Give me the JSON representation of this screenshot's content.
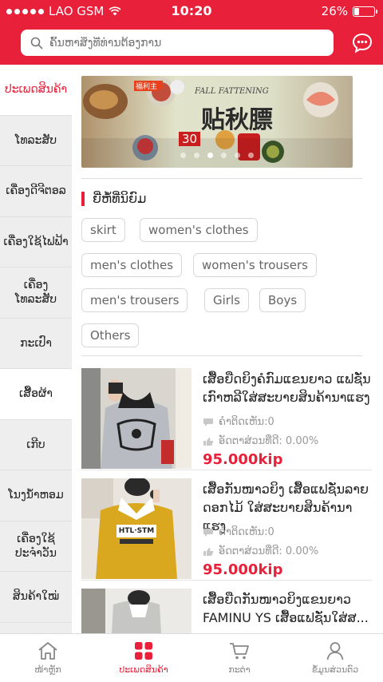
{
  "status_bar": {
    "carrier": "LAO GSM",
    "time": "10:20",
    "battery": "26%",
    "battery_level": 0.26
  },
  "search": {
    "placeholder": "ຄົ້ນຫາສິ່ງທີ່ທ່ານຕ້ອງການ"
  },
  "sidebar": {
    "items": [
      {
        "label": "ປະເພດສິນຄ້າ"
      },
      {
        "label": "ໂທລະສັບ"
      },
      {
        "label": "ເຄື່ອງດີຈີຕອລ"
      },
      {
        "label": "ເຄື່ອງໃຊ້ໄຟຟ້າ"
      },
      {
        "label": "ເຄື່ອງໂທລະສັບ"
      },
      {
        "label": "ກະເປົາ"
      },
      {
        "label": "ເສື້ອຜ້າ"
      },
      {
        "label": "ເກີບ"
      },
      {
        "label": "ໂນງນ້ຳຫອມ"
      },
      {
        "label": "ເຄື່ອງໃຊ້ ປະຈຳວັນ"
      },
      {
        "label": "ສິນຄ້າໃໝ່"
      }
    ]
  },
  "section": {
    "title": "ຍີ່ຫໍ້ທີ່ນິຍົມ"
  },
  "tags": [
    {
      "label": "skirt"
    },
    {
      "label": "women's clothes"
    },
    {
      "label": "men's clothes"
    },
    {
      "label": "women's trousers"
    },
    {
      "label": "men's trousers"
    },
    {
      "label": "Girls"
    },
    {
      "label": "Boys"
    },
    {
      "label": "Others"
    }
  ],
  "products": [
    {
      "title": "ເສື້ອຍືດຍິງຄໍກົມແຂນຍາວ ແຟຊັ່ນເກົາຫລີໃສ່ສະບາຍສິນຄ້ານາແຮງ",
      "comments": "ຄຳຕິດເຫັນ:0",
      "rating": "ອັດຕາສ່ວນທີ່ດີ: 0.00%",
      "price": "95.000kip"
    },
    {
      "title": "ເສື້ອກັນໜາວຍິງ ເສື້ອແຟຊັ່ນລາຍດອກໄມ້ ໃສ່ສະບາຍສິນຄ້ານາແຮງ",
      "comments": "ຄຳຕິດເຫັນ:0",
      "rating": "ອັດຕາສ່ວນທີ່ດີ: 0.00%",
      "price": "95.000kip"
    },
    {
      "title": "ເສື້ອຍືດກັນໜາວຍິງແຂນຍາວ FAMINU YS ເສື້ອແຟຊັ່ນໃສ່ສ..."
    }
  ],
  "banner": {
    "badge": "福利主",
    "tagline": "FALL FATTENING",
    "headline": "贴秋膘",
    "promo": "30",
    "slides": 6,
    "active_slide": 2
  },
  "thumbs": {
    "shirt2": "HTL·STM"
  },
  "tabbar": {
    "items": [
      {
        "label": "ໜ້າຫຼັກ",
        "icon": "home-icon"
      },
      {
        "label": "ປະເພດສິນຄ້າ",
        "icon": "grid-icon"
      },
      {
        "label": "ກະຕ່າ",
        "icon": "cart-icon"
      },
      {
        "label": "ຂໍ້ມູນສ່ວນຕົວ",
        "icon": "user-icon"
      }
    ],
    "active": 1
  },
  "colors": {
    "accent": "#e8203a",
    "sidebar_bg": "#eeeeee",
    "price": "#e8203a"
  }
}
